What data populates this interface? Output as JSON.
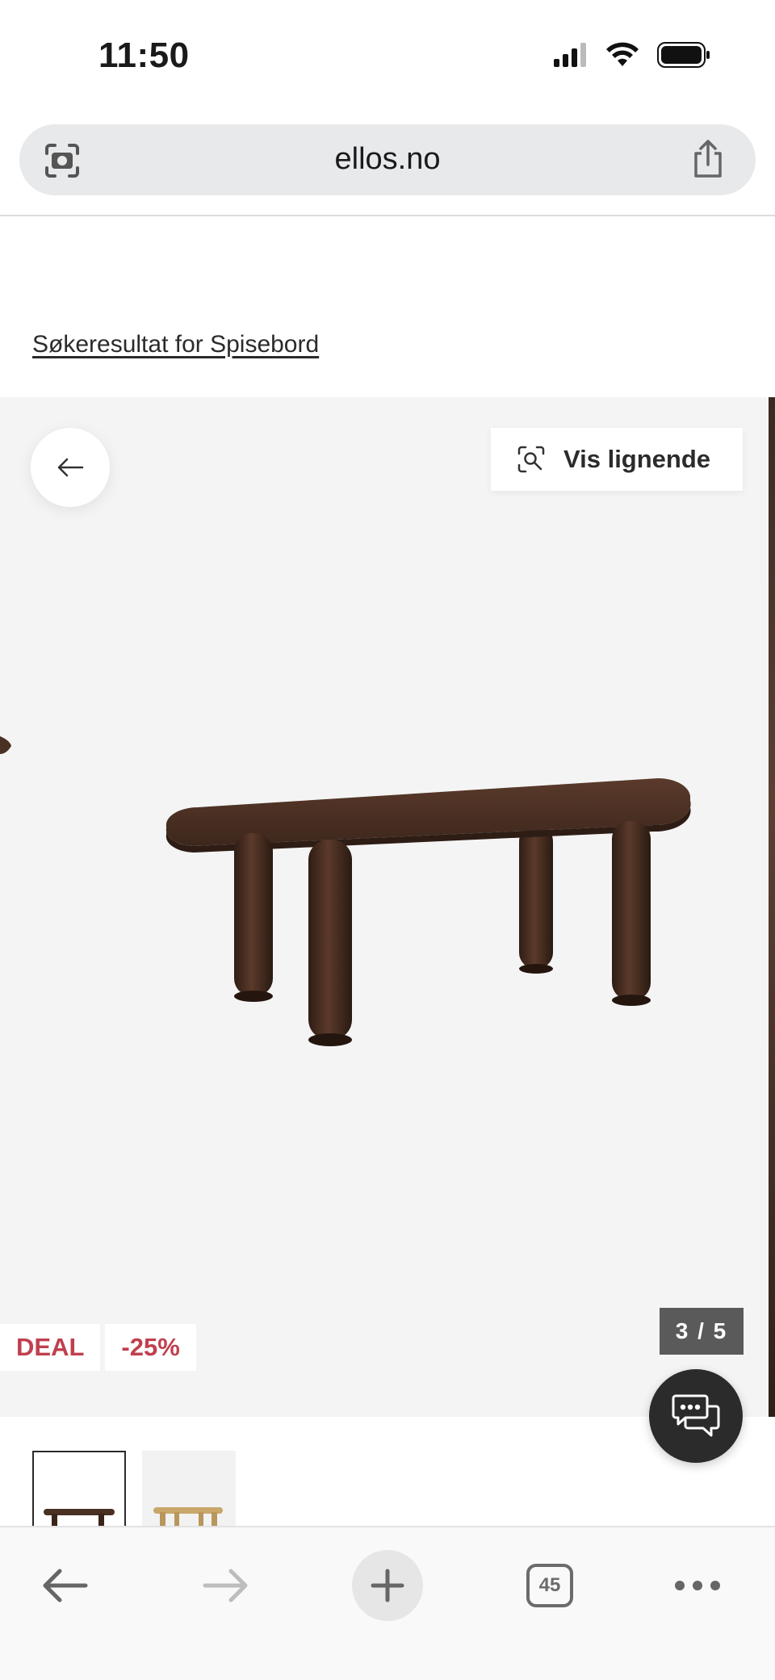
{
  "status_bar": {
    "time": "11:50"
  },
  "browser": {
    "url": "ellos.no",
    "tab_count": "45"
  },
  "breadcrumb": {
    "label": "Søkeresultat for Spisebord"
  },
  "gallery": {
    "similar_label": "Vis lignende",
    "badges": {
      "deal": "DEAL",
      "discount": "-25%"
    },
    "counter": "3 / 5"
  },
  "icons": {
    "camera_search": "camera-search-icon",
    "share": "share-icon",
    "back": "arrow-left-icon",
    "visual_search": "visual-search-icon",
    "chat": "chat-icon",
    "nav_back": "back-icon",
    "nav_forward": "forward-icon",
    "new_tab": "plus-icon",
    "more": "more-icon"
  },
  "colors": {
    "accent_red": "#c0404f",
    "gallery_bg": "#f4f4f4",
    "wood": "#4a3023"
  }
}
